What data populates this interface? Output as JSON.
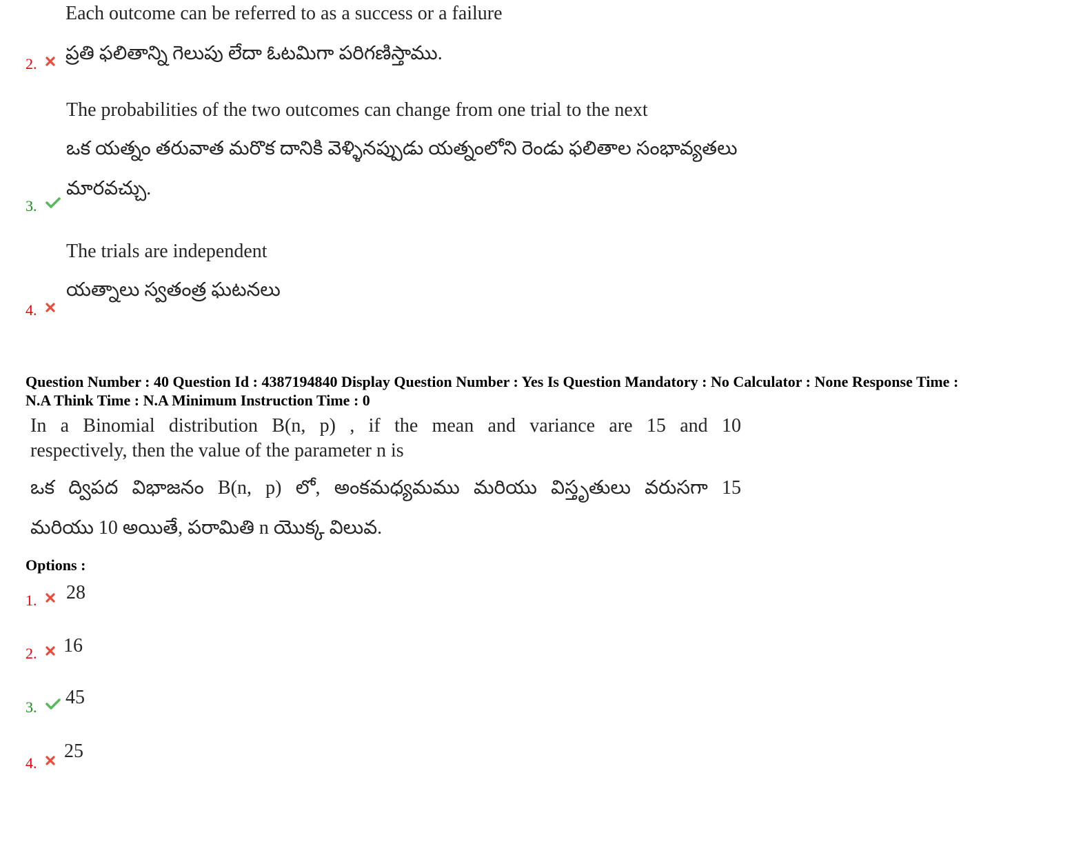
{
  "prev_question": {
    "options": [
      {
        "number": "2.",
        "status": "wrong",
        "lines": [
          "Each outcome can be referred to as a success or a failure",
          "ప్రతి ఫలితాన్ని గెలుపు లేదా ఓటమిగా పరిగణిస్తాము."
        ]
      },
      {
        "number": "3.",
        "status": "correct",
        "lines": [
          "The probabilities of the two outcomes can change from one trial to the next",
          "ఒక యత్నం తరువాత మరొక దానికి వెళ్ళినప్పుడు యత్నంలోని రెండు ఫలితాల సంభావ్యతలు",
          "మారవచ్చు."
        ]
      },
      {
        "number": "4.",
        "status": "wrong",
        "lines": [
          "The trials are independent",
          "యత్నాలు స్వతంత్ర ఘటనలు"
        ]
      }
    ]
  },
  "question": {
    "meta_line1": "Question Number : 40 Question Id : 4387194840 Display Question Number : Yes Is Question Mandatory : No Calculator : None Response Time :",
    "meta_line2": "N.A Think Time : N.A Minimum Instruction Time : 0",
    "english_line1": "In a Binomial distribution B(n, p) , if the mean and variance are 15 and 10",
    "english_line2": "respectively, then the value of the parameter n is",
    "telugu_line1": "ఒక ద్విపద విభాజనం B(n, p) లో, అంకమధ్యమము మరియు విస్తృతులు వరుసగా 15",
    "telugu_line2": "మరియు 10 అయితే, పరామితి n యొక్క విలువ.",
    "options_label": "Options :",
    "options": [
      {
        "number": "1.",
        "status": "wrong",
        "value": "28"
      },
      {
        "number": "2.",
        "status": "wrong",
        "value": "16"
      },
      {
        "number": "3.",
        "status": "correct",
        "value": "45"
      },
      {
        "number": "4.",
        "status": "wrong",
        "value": "25"
      }
    ]
  },
  "colors": {
    "wrong": "#e8000b",
    "correct": "#1a8c1a",
    "text": "#262626"
  }
}
